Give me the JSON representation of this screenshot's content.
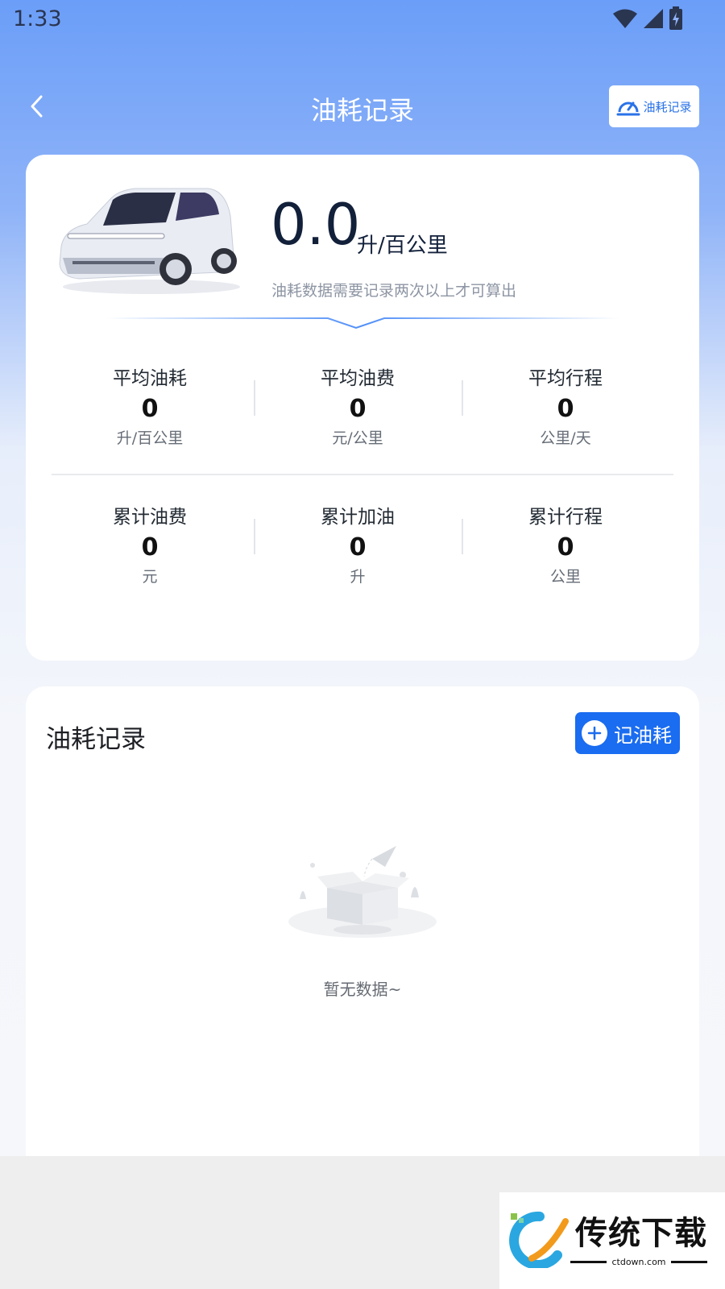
{
  "status_bar": {
    "time": "1:33",
    "icons": [
      "wifi-icon",
      "signal-icon",
      "battery-charging-icon"
    ]
  },
  "header": {
    "title": "油耗记录",
    "back_icon": "chevron-left-icon",
    "chip_label": "油耗记录",
    "chip_icon": "gauge-icon"
  },
  "summary": {
    "value": "0.0",
    "unit": "升/百公里",
    "hint": "油耗数据需要记录两次以上才可算出",
    "rows": [
      [
        {
          "label": "平均油耗",
          "value": "0",
          "unit": "升/百公里"
        },
        {
          "label": "平均油费",
          "value": "0",
          "unit": "元/公里"
        },
        {
          "label": "平均行程",
          "value": "0",
          "unit": "公里/天"
        }
      ],
      [
        {
          "label": "累计油费",
          "value": "0",
          "unit": "元"
        },
        {
          "label": "累计加油",
          "value": "0",
          "unit": "升"
        },
        {
          "label": "累计行程",
          "value": "0",
          "unit": "公里"
        }
      ]
    ]
  },
  "records": {
    "title": "油耗记录",
    "add_button_label": "记油耗",
    "empty_text": "暂无数据~"
  },
  "watermark": {
    "text": "传统下载",
    "sub": "ctdown.com"
  },
  "colors": {
    "accent": "#1a6cf0",
    "header_gradient_top": "#6b9ef8",
    "text_dark": "#12203a"
  }
}
